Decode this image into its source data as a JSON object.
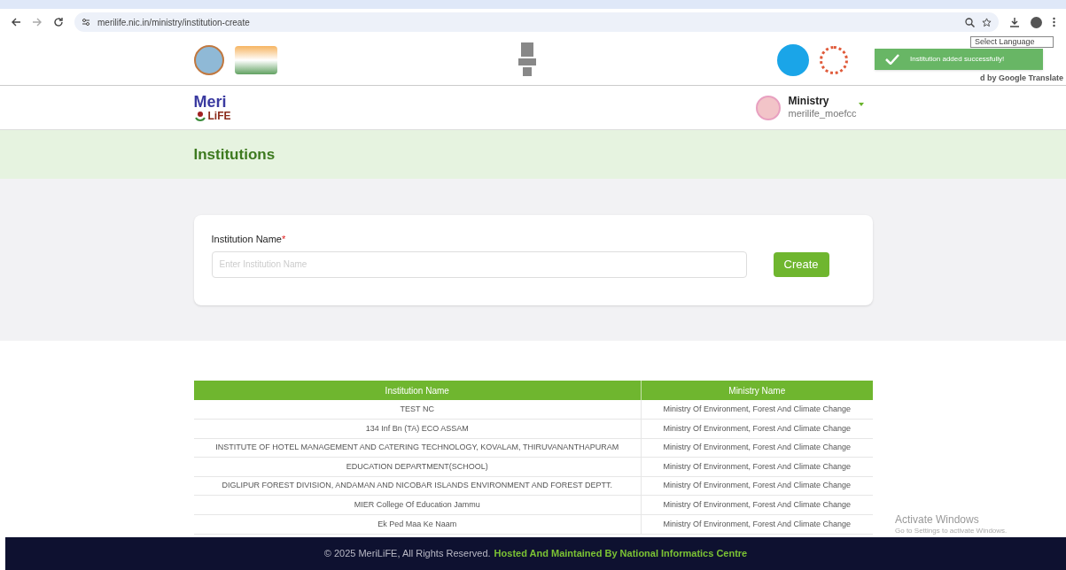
{
  "browser": {
    "url": "merilife.nic.in/ministry/institution-create"
  },
  "header": {
    "language_select": "Select Language",
    "translate_credit": "d by Google Translate"
  },
  "toast": {
    "message": "Institution added successfully!"
  },
  "logo": {
    "line_1": "Meri",
    "line_2": "LiFE"
  },
  "user": {
    "name": "Ministry",
    "username": "merilife_moefcc"
  },
  "page_title": "Institutions",
  "form": {
    "label": "Institution Name",
    "required_mark": "*",
    "placeholder": "Enter Institution Name",
    "button": "Create"
  },
  "table": {
    "columns": [
      "Institution Name",
      "Ministry Name"
    ],
    "rows": [
      [
        "TEST NC",
        "Ministry Of Environment, Forest And Climate Change"
      ],
      [
        "134 Inf Bn (TA) ECO ASSAM",
        "Ministry Of Environment, Forest And Climate Change"
      ],
      [
        "INSTITUTE OF HOTEL MANAGEMENT AND CATERING TECHNOLOGY, KOVALAM, THIRUVANANTHAPURAM",
        "Ministry Of Environment, Forest And Climate Change"
      ],
      [
        "EDUCATION DEPARTMENT(SCHOOL)",
        "Ministry Of Environment, Forest And Climate Change"
      ],
      [
        "DIGLIPUR FOREST DIVISION, ANDAMAN AND NICOBAR ISLANDS ENVIRONMENT AND FOREST DEPTT.",
        "Ministry Of Environment, Forest And Climate Change"
      ],
      [
        "MIER College Of Education Jammu",
        "Ministry Of Environment, Forest And Climate Change"
      ],
      [
        "Ek Ped Maa Ke Naam",
        "Ministry Of Environment, Forest And Climate Change"
      ]
    ]
  },
  "footer": {
    "copyright": "© 2025 MeriLiFE, All Rights Reserved.",
    "credit": "Hosted And Maintained By National Informatics Centre"
  },
  "os_overlay": {
    "title": "Activate Windows",
    "subtitle": "Go to Settings to activate Windows."
  }
}
